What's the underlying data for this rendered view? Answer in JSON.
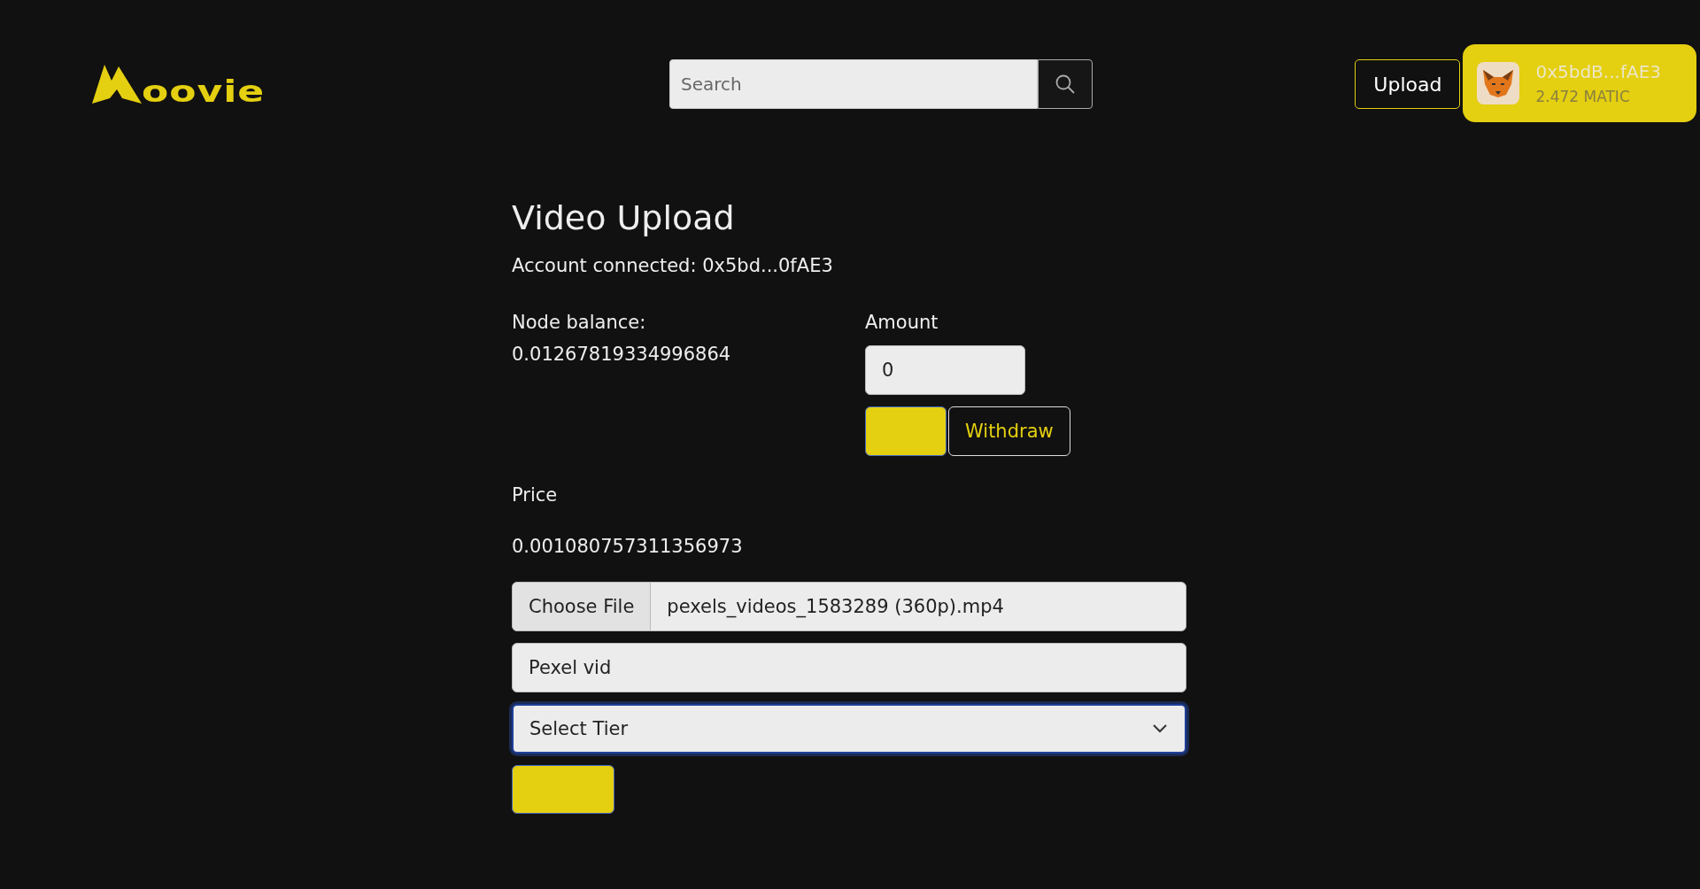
{
  "header": {
    "logo": {
      "text": "oovie"
    },
    "search": {
      "placeholder": "Search"
    },
    "upload_button": "Upload",
    "wallet": {
      "address": "0x5bdB...fAE3",
      "balance": "2.472 MATIC"
    }
  },
  "form": {
    "title": "Video Upload",
    "account": "Account connected: 0x5bd...0fAE3",
    "node_balance": {
      "label": "Node balance:",
      "value": "0.01267819334996864"
    },
    "amount": {
      "label": "Amount",
      "value": "0",
      "withdraw_button": "Withdraw"
    },
    "price": {
      "label": "Price",
      "value": "0.001080757311356973"
    },
    "file": {
      "button": "Choose File",
      "filename": "pexels_videos_1583289 (360p).mp4"
    },
    "name_field": {
      "value": "Pexel vid"
    },
    "tier_select": {
      "value": "Select Tier",
      "focused": true
    }
  }
}
